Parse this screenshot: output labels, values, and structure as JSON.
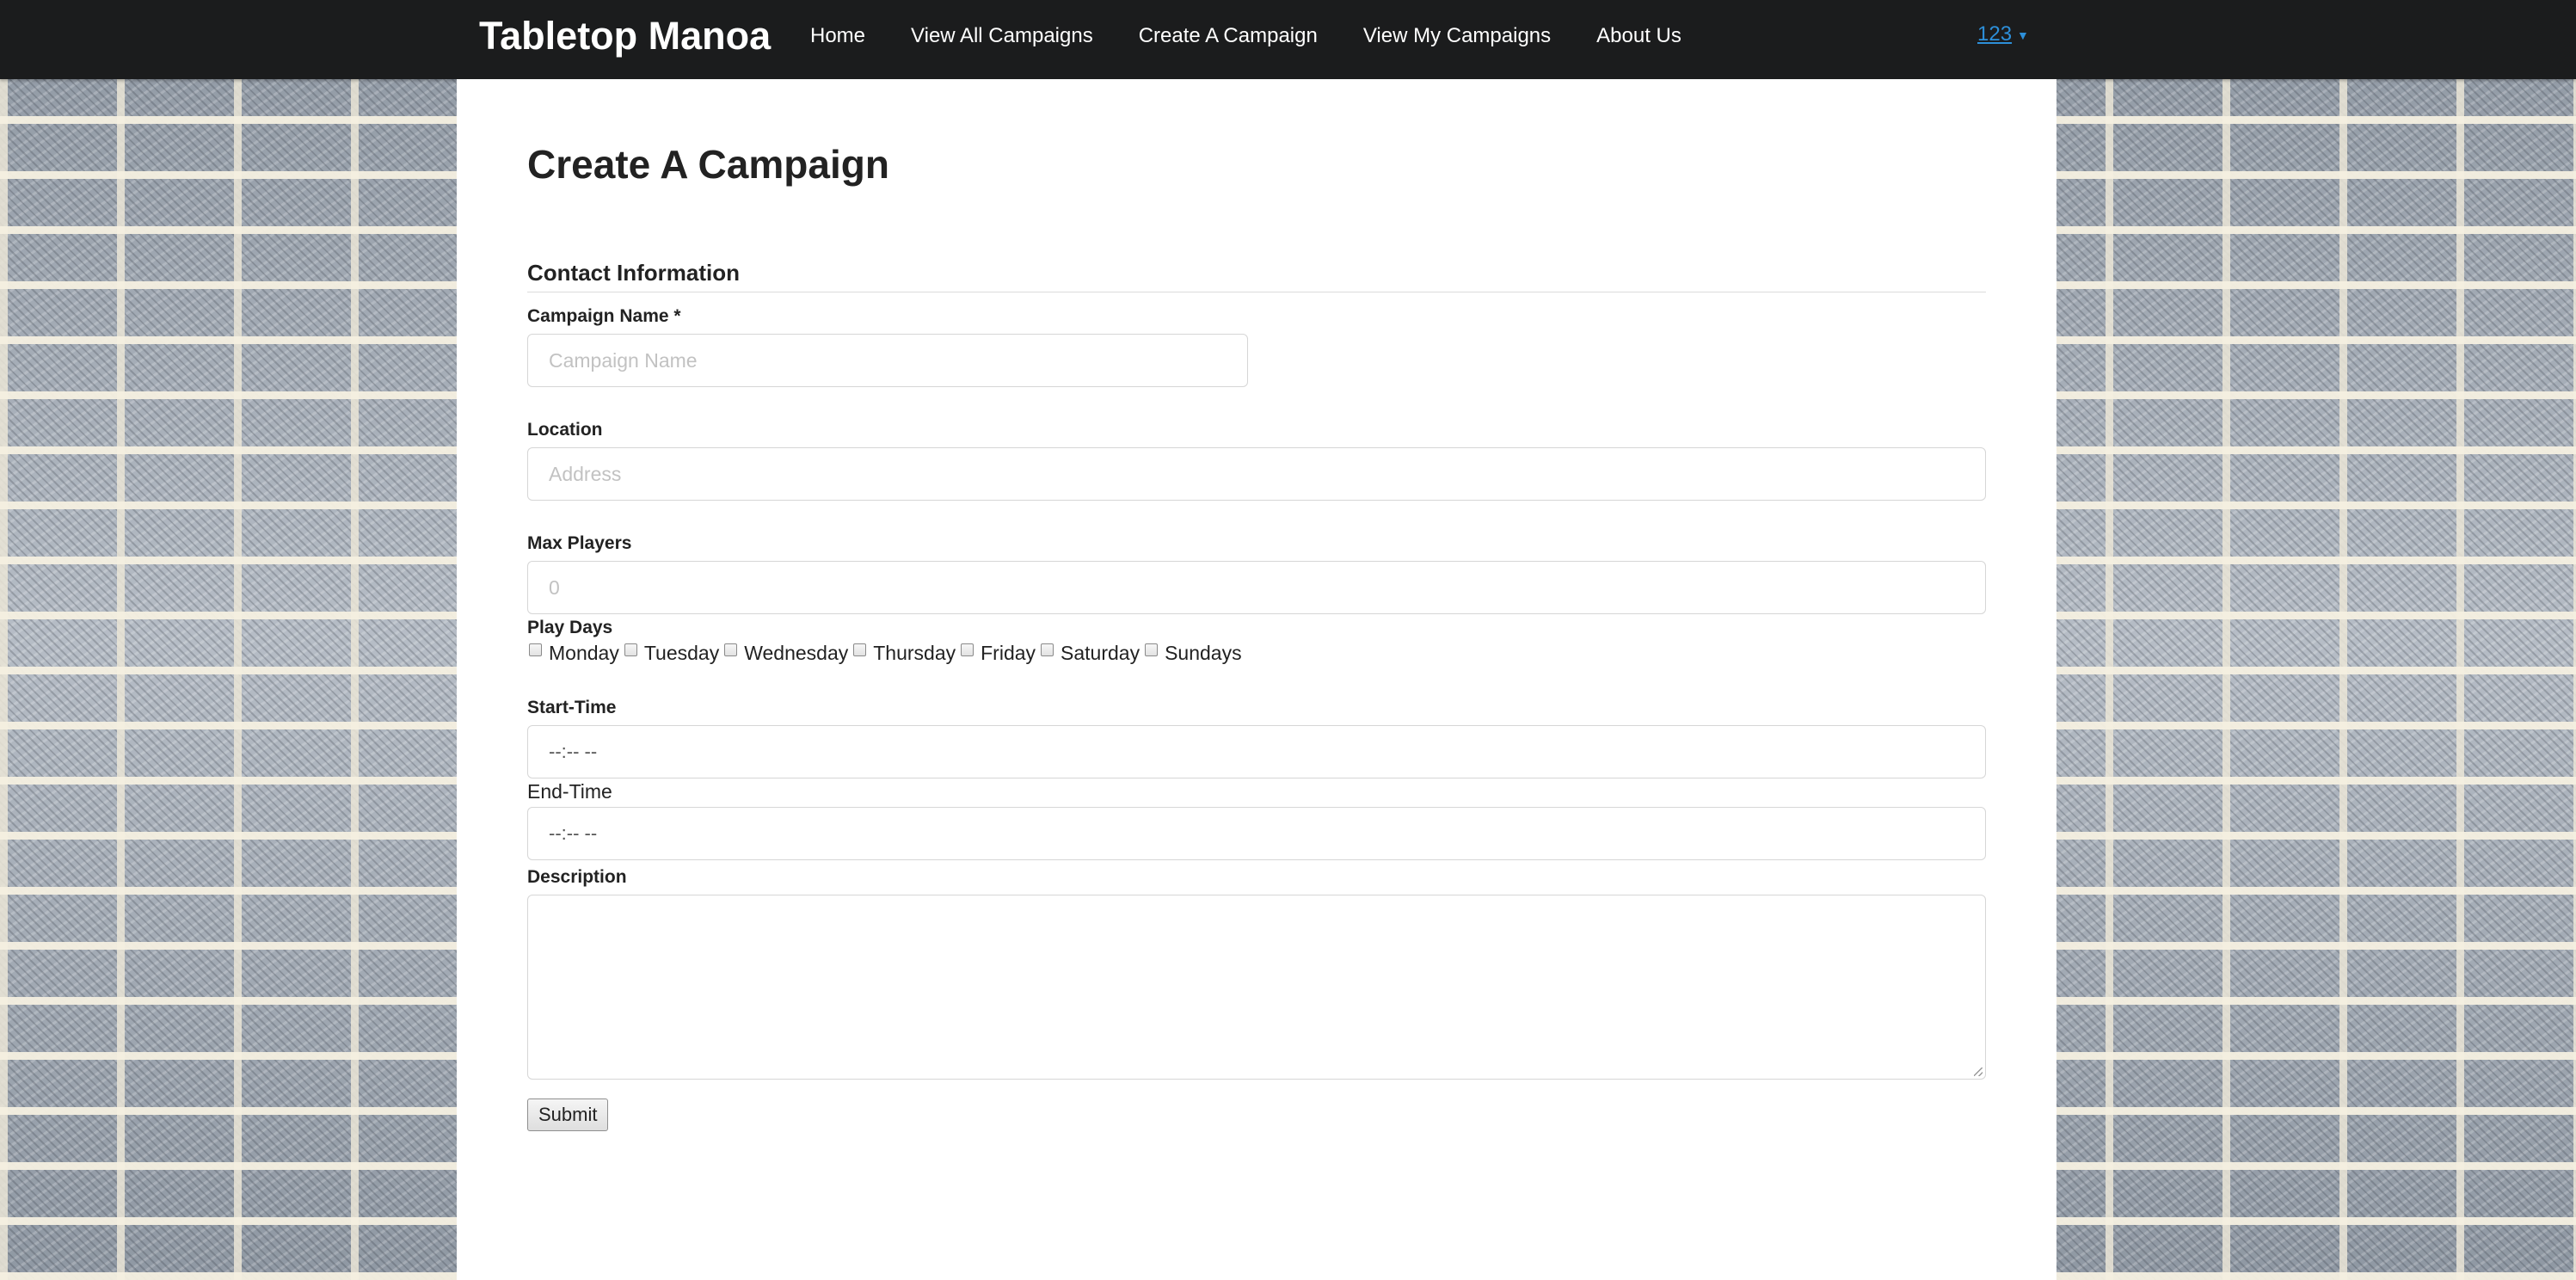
{
  "navbar": {
    "brand": "Tabletop Manoa",
    "items": [
      {
        "label": "Home"
      },
      {
        "label": "View All Campaigns"
      },
      {
        "label": "Create A Campaign"
      },
      {
        "label": "View My Campaigns"
      },
      {
        "label": "About Us"
      }
    ],
    "user": {
      "label": "123",
      "caret": "▼"
    }
  },
  "page": {
    "title": "Create A Campaign"
  },
  "form": {
    "section_header": "Contact Information",
    "campaign_name": {
      "label": "Campaign Name *",
      "placeholder": "Campaign Name",
      "value": ""
    },
    "location": {
      "label": "Location",
      "placeholder": "Address",
      "value": ""
    },
    "max_players": {
      "label": "Max Players",
      "placeholder": "0",
      "value": ""
    },
    "play_days": {
      "label": "Play Days",
      "days": [
        {
          "label": "Monday",
          "checked": false
        },
        {
          "label": "Tuesday",
          "checked": false
        },
        {
          "label": "Wednesday",
          "checked": false
        },
        {
          "label": "Thursday",
          "checked": false
        },
        {
          "label": "Friday",
          "checked": false
        },
        {
          "label": "Saturday",
          "checked": false
        },
        {
          "label": "Sundays",
          "checked": false
        }
      ]
    },
    "start_time": {
      "label": "Start-Time",
      "value": "--:-- --"
    },
    "end_time": {
      "label": "End-Time",
      "value": "--:-- --"
    },
    "description": {
      "label": "Description",
      "value": ""
    },
    "submit_label": "Submit"
  },
  "colors": {
    "navbar_bg": "#1b1c1d",
    "link_blue": "#2d8fd9",
    "content_bg": "#ffffff"
  }
}
